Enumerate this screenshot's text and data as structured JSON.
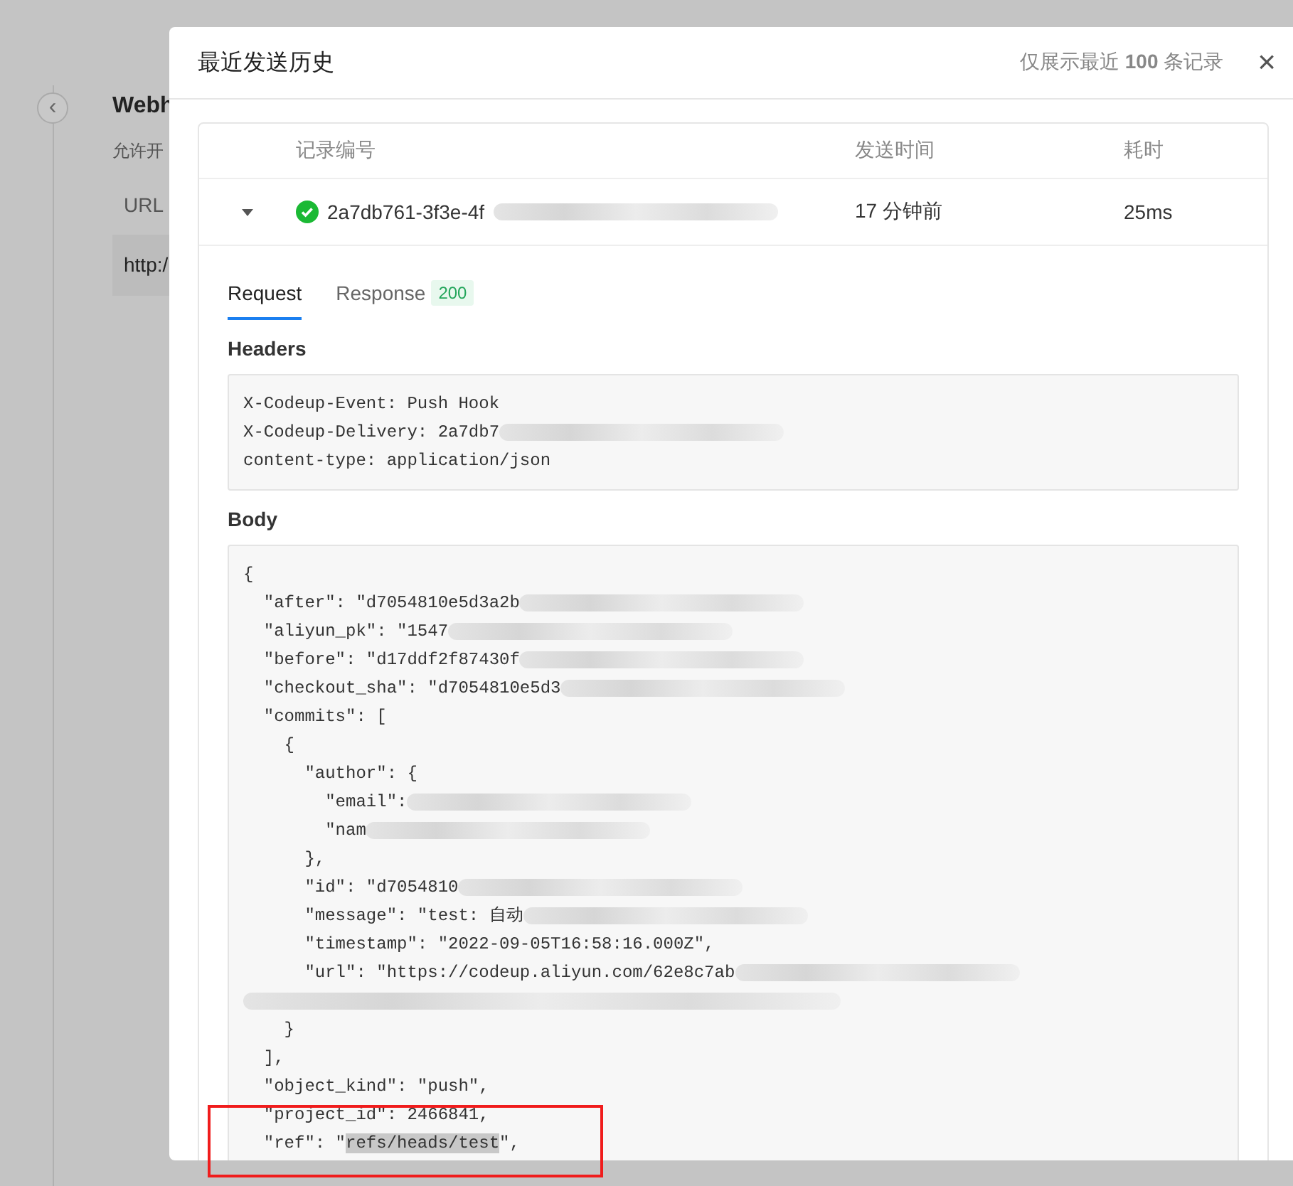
{
  "background_page": {
    "back_button": "‹",
    "title": "Webh",
    "description": "允许开",
    "table_header": "URL",
    "table_cell": "http:/"
  },
  "dialog": {
    "title": "最近发送历史",
    "note": "仅展示最近 **100** 条记录",
    "close": "×",
    "table": {
      "columns": [
        "记录编号",
        "发送时间",
        "耗时"
      ],
      "rows": [
        {
          "expanded": true,
          "success": true,
          "id": "2a7db761-3f3e-4f",
          "redacted": true,
          "time": "17 分钟前",
          "duration": "25ms"
        }
      ]
    },
    "tabs": [
      {
        "label": "Request",
        "selected": true
      },
      {
        "label": "Response",
        "selected": false,
        "badge": "200"
      }
    ],
    "headers_label": "Headers",
    "headers": [
      {
        "text": "X-Codeup-Event: Push Hook",
        "redacted": false
      },
      {
        "text": "X-Codeup-Delivery: 2a7db7",
        "redacted": true
      },
      {
        "text": "content-type: application/json",
        "redacted": false
      }
    ],
    "body_label": "Body",
    "body": [
      {
        "text": "{",
        "redacted": false
      },
      {
        "text": "  \"after\": \"d7054810e5d3a2b",
        "redacted": true
      },
      {
        "text": "  \"aliyun_pk\": \"1547",
        "redacted": true
      },
      {
        "text": "  \"before\": \"d17ddf2f87430f",
        "redacted": true
      },
      {
        "text": "  \"checkout_sha\": \"d7054810e5d3",
        "redacted": true
      },
      {
        "text": "  \"commits\": [",
        "redacted": false
      },
      {
        "text": "    {",
        "redacted": false
      },
      {
        "text": "      \"author\": {",
        "redacted": false
      },
      {
        "text": "        \"email\":",
        "redacted": true
      },
      {
        "text": "        \"nam",
        "redacted": true
      },
      {
        "text": "      },",
        "redacted": false
      },
      {
        "text": "      \"id\": \"d7054810",
        "redacted": true
      },
      {
        "text": "      \"message\": \"test: 自动",
        "redacted": true
      },
      {
        "text": "      \"timestamp\": \"2022-09-05T16:58:16.000Z\",",
        "redacted": false
      },
      {
        "text": "      \"url\": \"https://codeup.aliyun.com/62e8c7ab",
        "redacted": true
      },
      {
        "redacted": true
      },
      {
        "text": "    }",
        "redacted": false
      },
      {
        "text": "  ],",
        "redacted": false
      },
      {
        "text": "  \"object_kind\": \"push\",",
        "redacted": false
      },
      {
        "text": "  \"project_id\": 2466841,",
        "redacted": false
      },
      {
        "text": "  \"ref\": \"",
        "selected_text": "refs/heads/test",
        "text_after": "\",",
        "redacted": false
      }
    ]
  }
}
